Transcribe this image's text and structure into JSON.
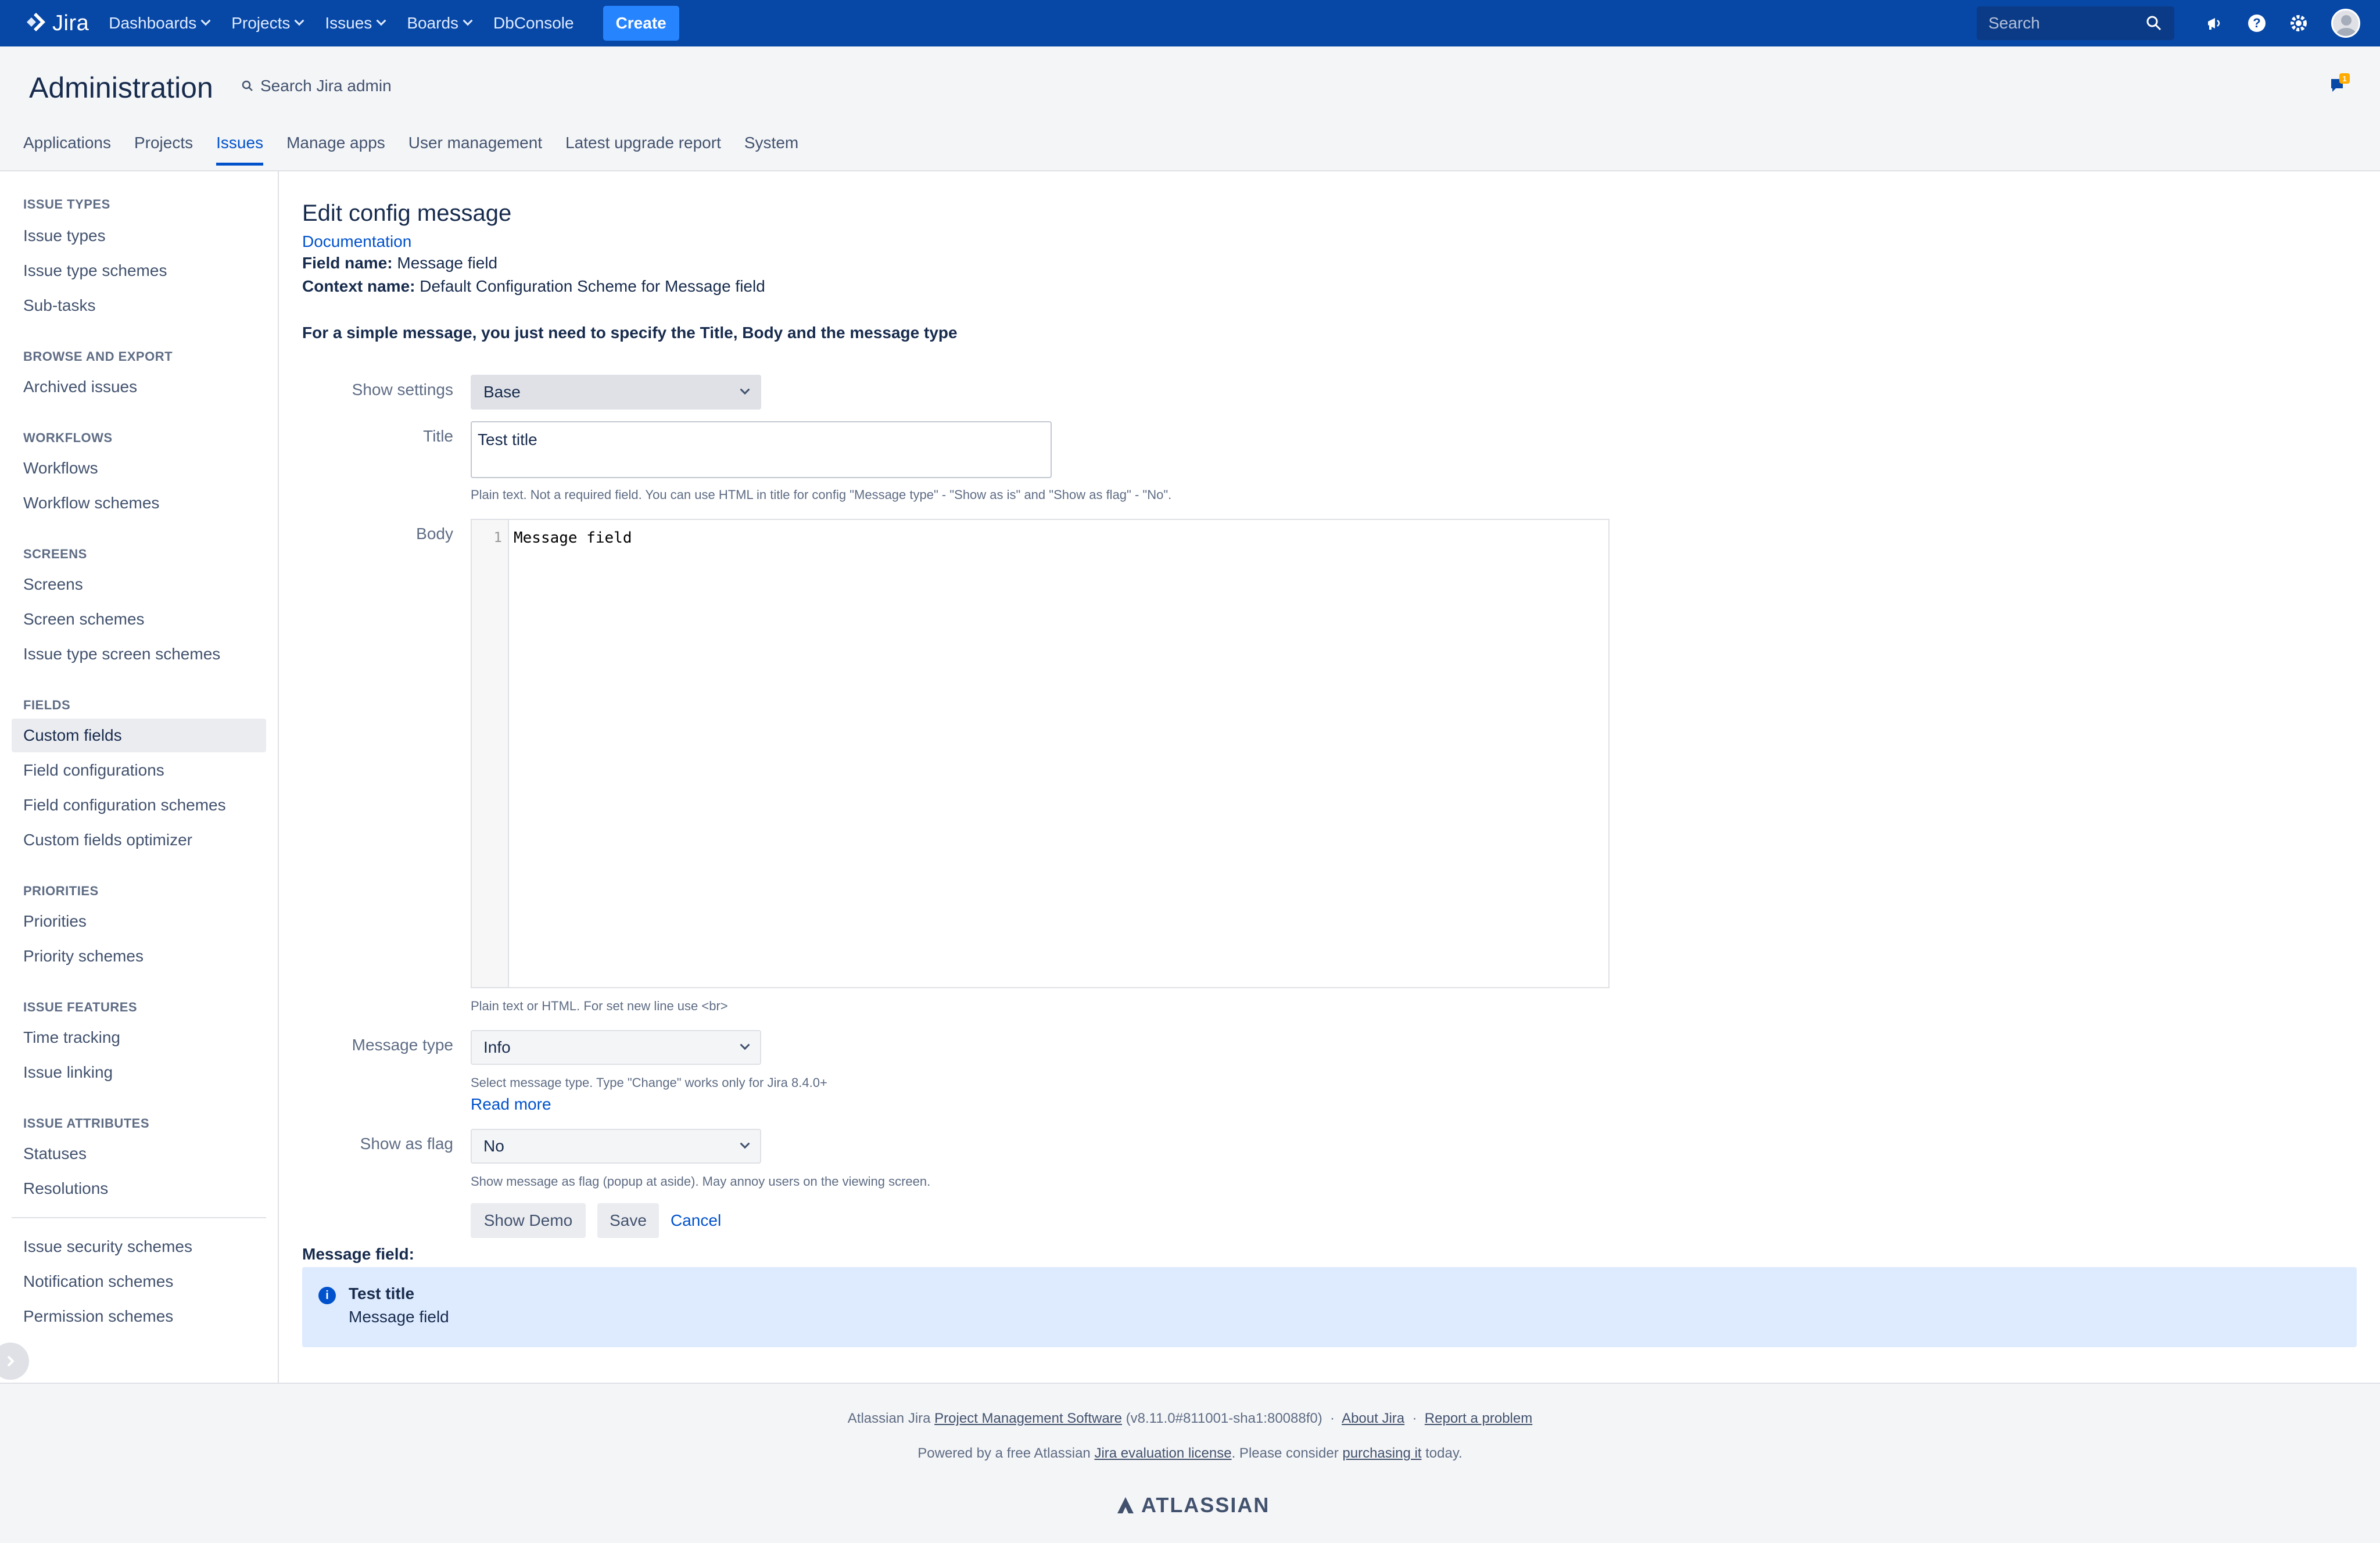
{
  "topnav": {
    "logo_text": "Jira",
    "items": [
      {
        "label": "Dashboards",
        "has_menu": true
      },
      {
        "label": "Projects",
        "has_menu": true
      },
      {
        "label": "Issues",
        "has_menu": true
      },
      {
        "label": "Boards",
        "has_menu": true
      },
      {
        "label": "DbConsole",
        "has_menu": false
      }
    ],
    "create_label": "Create",
    "search_placeholder": "Search",
    "brand_color": "#0747a6"
  },
  "admin": {
    "title": "Administration",
    "search_label": "Search Jira admin",
    "notification_count": "1",
    "tabs": [
      "Applications",
      "Projects",
      "Issues",
      "Manage apps",
      "User management",
      "Latest upgrade report",
      "System"
    ],
    "active_tab": "Issues"
  },
  "sidebar": {
    "sections": [
      {
        "title": "ISSUE TYPES",
        "items": [
          "Issue types",
          "Issue type schemes",
          "Sub-tasks"
        ]
      },
      {
        "title": "BROWSE AND EXPORT",
        "items": [
          "Archived issues"
        ]
      },
      {
        "title": "WORKFLOWS",
        "items": [
          "Workflows",
          "Workflow schemes"
        ]
      },
      {
        "title": "SCREENS",
        "items": [
          "Screens",
          "Screen schemes",
          "Issue type screen schemes"
        ]
      },
      {
        "title": "FIELDS",
        "items": [
          "Custom fields",
          "Field configurations",
          "Field configuration schemes",
          "Custom fields optimizer"
        ]
      },
      {
        "title": "PRIORITIES",
        "items": [
          "Priorities",
          "Priority schemes"
        ]
      },
      {
        "title": "ISSUE FEATURES",
        "items": [
          "Time tracking",
          "Issue linking"
        ]
      },
      {
        "title": "ISSUE ATTRIBUTES",
        "items": [
          "Statuses",
          "Resolutions"
        ]
      }
    ],
    "extra_items": [
      "Issue security schemes",
      "Notification schemes",
      "Permission schemes"
    ],
    "active_item": "Custom fields"
  },
  "main": {
    "page_title": "Edit config message",
    "documentation_link": "Documentation",
    "field_name_label": "Field name:",
    "field_name_value": "Message field",
    "context_name_label": "Context name:",
    "context_name_value": "Default Configuration Scheme for Message field",
    "hint": "For a simple message, you just need to specify the Title, Body and the message type",
    "form": {
      "show_settings_label": "Show settings",
      "show_settings_value": "Base",
      "title_label": "Title",
      "title_value": "Test title",
      "title_help": "Plain text. Not a required field. You can use HTML in title for config \"Message type\" - \"Show as is\" and \"Show as flag\" - \"No\".",
      "body_label": "Body",
      "body_line_number": "1",
      "body_value": "Message field",
      "body_help": "Plain text or HTML. For set new line use <br>",
      "message_type_label": "Message type",
      "message_type_value": "Info",
      "message_type_help": "Select message type. Type \"Change\" works only for Jira 8.4.0+",
      "read_more": "Read more",
      "show_as_flag_label": "Show as flag",
      "show_as_flag_value": "No",
      "show_as_flag_help": "Show message as flag (popup at aside). May annoy users on the viewing screen.",
      "show_demo_label": "Show Demo",
      "save_label": "Save",
      "cancel_label": "Cancel"
    },
    "preview": {
      "label": "Message field:",
      "title": "Test title",
      "body": "Message field"
    }
  },
  "footer": {
    "line1_prefix": "Atlassian Jira",
    "line1_link1": "Project Management Software",
    "line1_version": "(v8.11.0#811001-sha1:80088f0)",
    "line1_link2": "About Jira",
    "line1_link3": "Report a problem",
    "line2_prefix": "Powered by a free Atlassian",
    "line2_link1": "Jira evaluation license",
    "line2_middle": ". Please consider",
    "line2_link2": "purchasing it",
    "line2_suffix": "today.",
    "logo_text": "ATLASSIAN"
  }
}
